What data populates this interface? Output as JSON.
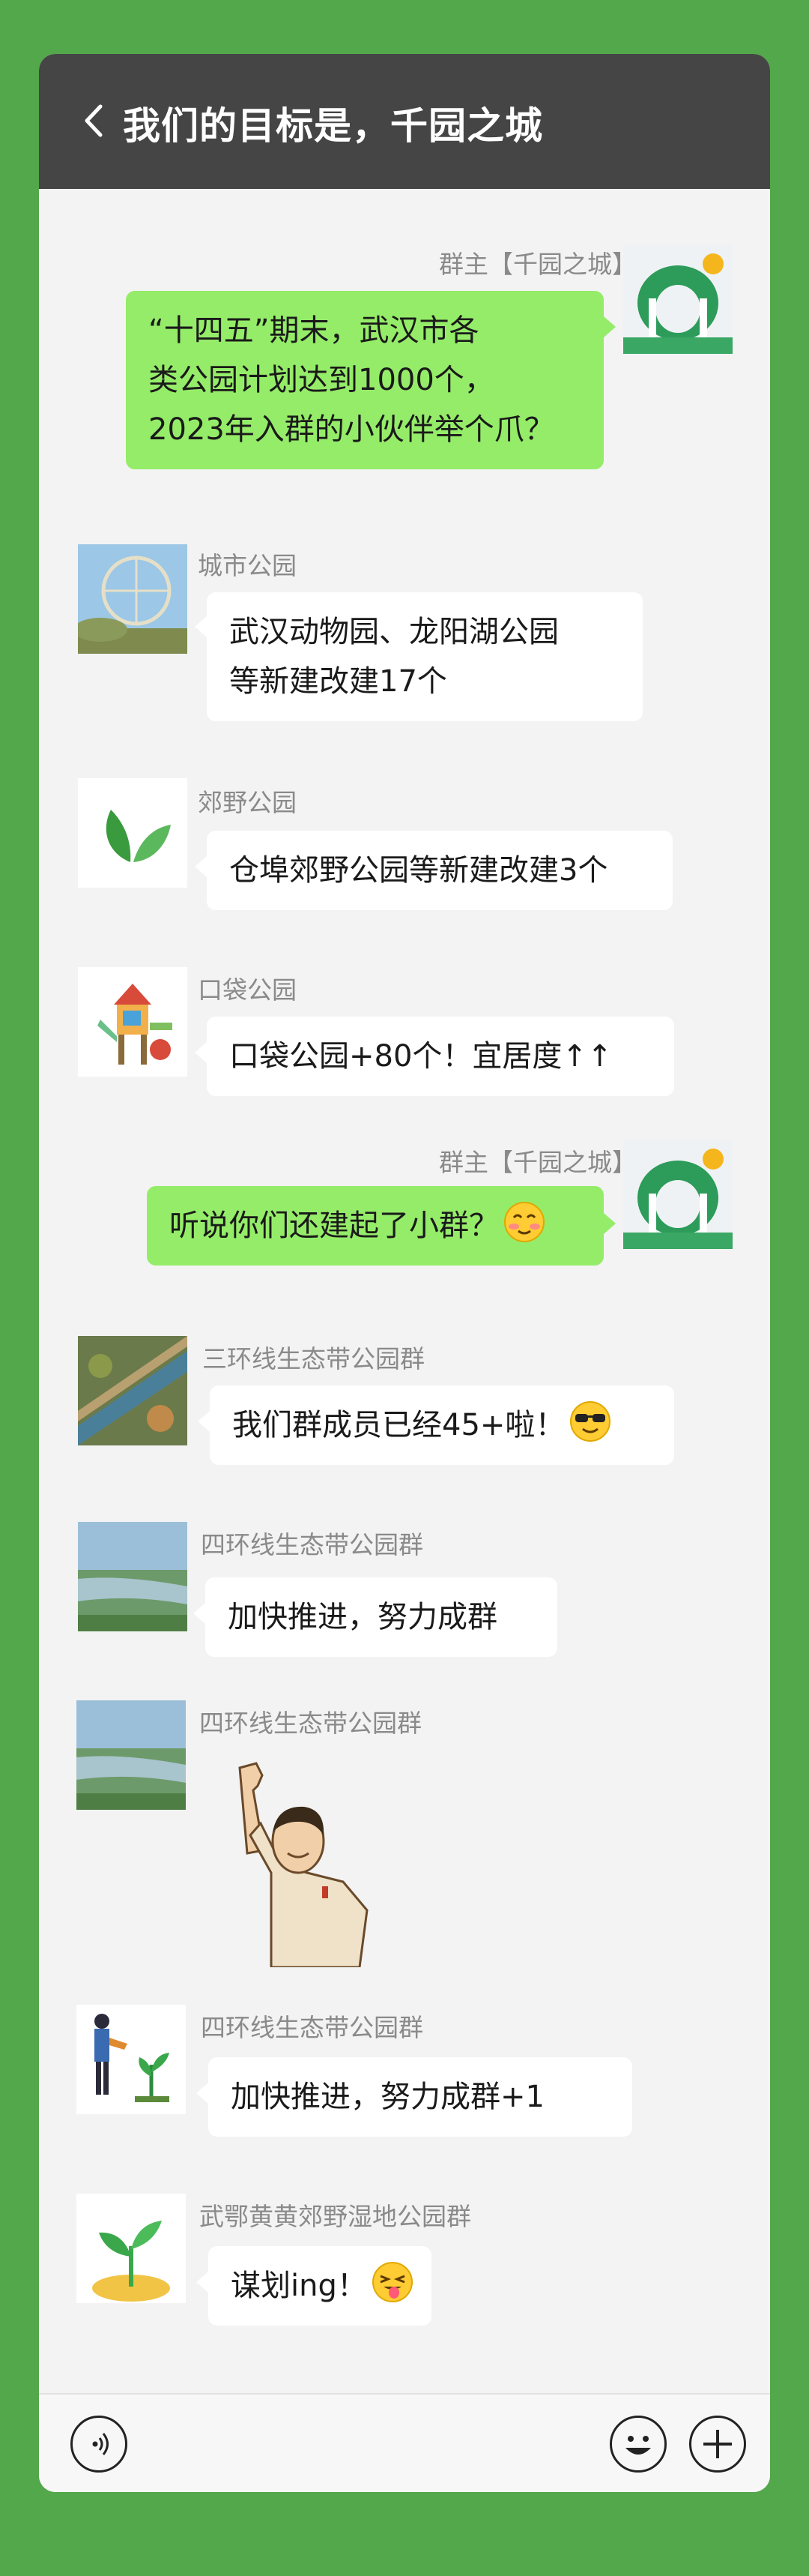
{
  "header": {
    "title": "我们的目标是，千园之城"
  },
  "messages": [
    {
      "sender": "群主【千园之城】",
      "lines": [
        "“十四五”期末，武汉市各",
        "类公园计划达到1000个，",
        "2023年入群的小伙伴举个爪？"
      ]
    },
    {
      "sender": "城市公园",
      "lines": [
        "武汉动物园、龙阳湖公园",
        "等新建改建17个"
      ]
    },
    {
      "sender": "郊野公园",
      "lines": [
        "仓埠郊野公园等新建改建3个"
      ]
    },
    {
      "sender": "口袋公园",
      "lines": [
        "口袋公园+80个！宜居度↑↑"
      ]
    },
    {
      "sender": "群主【千园之城】",
      "lines": [
        "听说你们还建起了小群？"
      ]
    },
    {
      "sender": "三环线生态带公园群",
      "lines": [
        "我们群成员已经45+啦！"
      ]
    },
    {
      "sender": "四环线生态带公园群",
      "lines": [
        "加快推进，努力成群"
      ]
    },
    {
      "sender": "四环线生态带公园群"
    },
    {
      "sender": "四环线生态带公园群",
      "lines": [
        "加快推进，努力成群+1"
      ]
    },
    {
      "sender": "武鄂黄黄郊野湿地公园群",
      "lines": [
        "谋划ing！"
      ]
    }
  ],
  "icons": {
    "back": "chevron-left-icon",
    "voice": "voice-icon",
    "emoji": "smiley-icon",
    "add": "plus-icon"
  },
  "colors": {
    "background": "#52a84a",
    "header": "#454545",
    "bubble_self": "#95ec69",
    "bubble_other": "#ffffff"
  }
}
